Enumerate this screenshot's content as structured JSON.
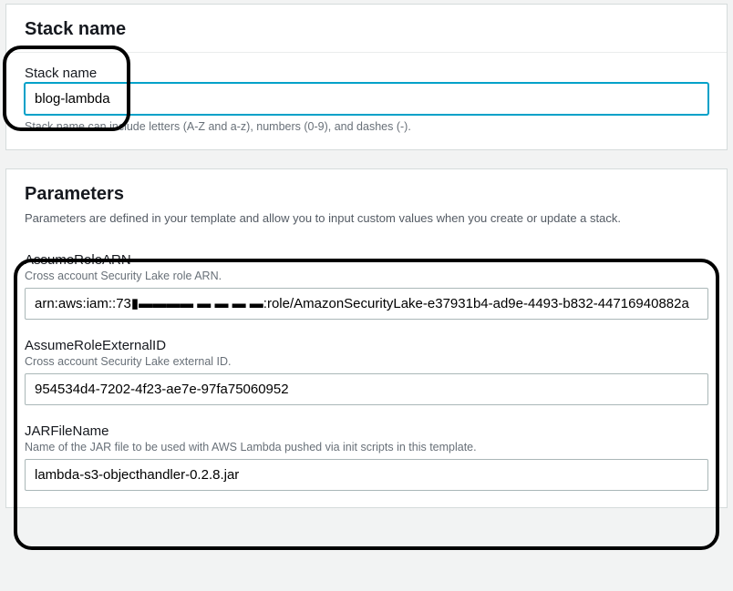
{
  "stackSection": {
    "title": "Stack name",
    "fieldLabel": "Stack name",
    "value": "blog-lambda",
    "helper": "Stack name can include letters (A-Z and a-z), numbers (0-9), and dashes (-)."
  },
  "parametersSection": {
    "title": "Parameters",
    "subtitle": "Parameters are defined in your template and allow you to input custom values when you create or update a stack.",
    "params": [
      {
        "name": "AssumeRoleARN",
        "description": "Cross account Security Lake role ARN.",
        "value": "arn:aws:iam::73▮▬▬▬▬ ▬ ▬ ▬ ▬:role/AmazonSecurityLake-e37931b4-ad9e-4493-b832-44716940882a"
      },
      {
        "name": "AssumeRoleExternalID",
        "description": "Cross account Security Lake external ID.",
        "value": "954534d4-7202-4f23-ae7e-97fa75060952"
      },
      {
        "name": "JARFileName",
        "description": "Name of the JAR file to be used with AWS Lambda pushed via init scripts in this template.",
        "value": "lambda-s3-objecthandler-0.2.8.jar"
      }
    ]
  }
}
